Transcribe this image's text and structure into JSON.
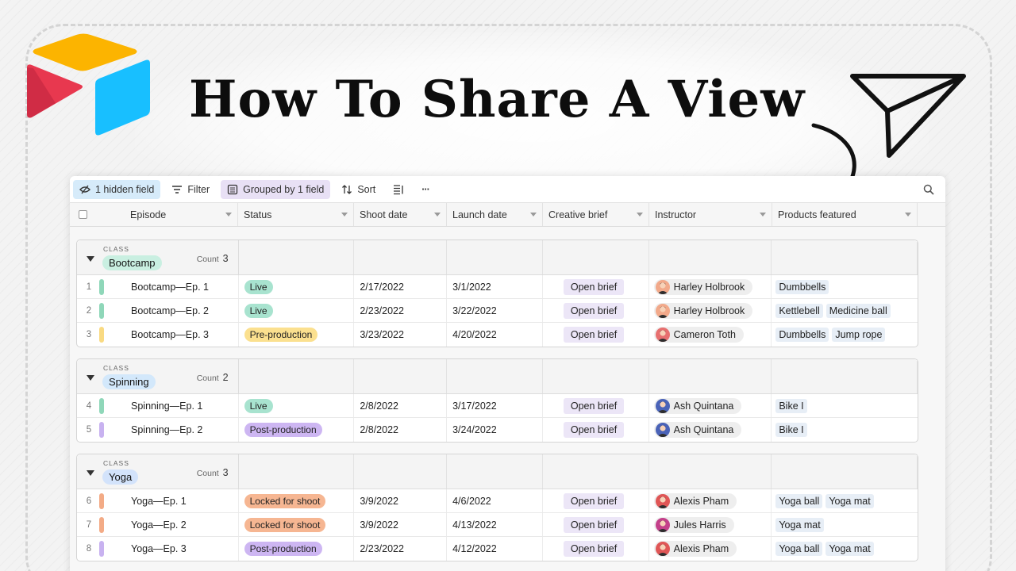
{
  "title": "How To Share A View",
  "colors": {
    "logo_yellow": "#fcb400",
    "logo_red": "#e8384f",
    "logo_blue": "#18bfff"
  },
  "toolbar": {
    "hidden_fields": "1 hidden field",
    "filter": "Filter",
    "grouped": "Grouped by 1 field",
    "sort": "Sort",
    "more": "···"
  },
  "columns": [
    "Episode",
    "Status",
    "Shoot date",
    "Launch date",
    "Creative brief",
    "Instructor",
    "Products featured"
  ],
  "status_colors": {
    "Live": "#a8e3cf",
    "Pre-production": "#fbe08f",
    "Post-production": "#cdb6f2",
    "Locked for shoot": "#f6b692"
  },
  "groups": [
    {
      "label": "CLASS",
      "name": "Bootcamp",
      "pill_color": "#c9efe1",
      "count_label": "Count",
      "count": "3",
      "rows": [
        {
          "num": "1",
          "bar": "#8fd7b9",
          "episode": "Bootcamp—Ep. 1",
          "status": "Live",
          "shoot": "2/17/2022",
          "launch": "3/1/2022",
          "brief": "Open brief",
          "instructor": "Harley Holbrook",
          "avatar": "#f2a98a",
          "products": [
            "Dumbbells"
          ]
        },
        {
          "num": "2",
          "bar": "#8fd7b9",
          "episode": "Bootcamp—Ep. 2",
          "status": "Live",
          "shoot": "2/23/2022",
          "launch": "3/22/2022",
          "brief": "Open brief",
          "instructor": "Harley Holbrook",
          "avatar": "#f2a98a",
          "products": [
            "Kettlebell",
            "Medicine ball"
          ]
        },
        {
          "num": "3",
          "bar": "#f9da82",
          "episode": "Bootcamp—Ep. 3",
          "status": "Pre-production",
          "shoot": "3/23/2022",
          "launch": "4/20/2022",
          "brief": "Open brief",
          "instructor": "Cameron Toth",
          "avatar": "#e76f6f",
          "products": [
            "Dumbbells",
            "Jump rope"
          ]
        }
      ]
    },
    {
      "label": "CLASS",
      "name": "Spinning",
      "pill_color": "#d3e8fb",
      "count_label": "Count",
      "count": "2",
      "rows": [
        {
          "num": "4",
          "bar": "#8fd7b9",
          "episode": "Spinning—Ep. 1",
          "status": "Live",
          "shoot": "2/8/2022",
          "launch": "3/17/2022",
          "brief": "Open brief",
          "instructor": "Ash Quintana",
          "avatar": "#4a63b8",
          "products": [
            "Bike I"
          ]
        },
        {
          "num": "5",
          "bar": "#c8b2f0",
          "episode": "Spinning—Ep. 2",
          "status": "Post-production",
          "shoot": "2/8/2022",
          "launch": "3/24/2022",
          "brief": "Open brief",
          "instructor": "Ash Quintana",
          "avatar": "#4a63b8",
          "products": [
            "Bike I"
          ]
        }
      ]
    },
    {
      "label": "CLASS",
      "name": "Yoga",
      "pill_color": "#d3e3fb",
      "count_label": "Count",
      "count": "3",
      "rows": [
        {
          "num": "6",
          "bar": "#f3ab86",
          "episode": "Yoga—Ep. 1",
          "status": "Locked for shoot",
          "shoot": "3/9/2022",
          "launch": "4/6/2022",
          "brief": "Open brief",
          "instructor": "Alexis Pham",
          "avatar": "#e05656",
          "products": [
            "Yoga ball",
            "Yoga mat"
          ]
        },
        {
          "num": "7",
          "bar": "#f3ab86",
          "episode": "Yoga—Ep. 2",
          "status": "Locked for shoot",
          "shoot": "3/9/2022",
          "launch": "4/13/2022",
          "brief": "Open brief",
          "instructor": "Jules Harris",
          "avatar": "#c4408a",
          "products": [
            "Yoga mat"
          ]
        },
        {
          "num": "8",
          "bar": "#c8b2f0",
          "episode": "Yoga—Ep. 3",
          "status": "Post-production",
          "shoot": "2/23/2022",
          "launch": "4/12/2022",
          "brief": "Open brief",
          "instructor": "Alexis Pham",
          "avatar": "#e05656",
          "products": [
            "Yoga ball",
            "Yoga mat"
          ]
        }
      ]
    }
  ]
}
